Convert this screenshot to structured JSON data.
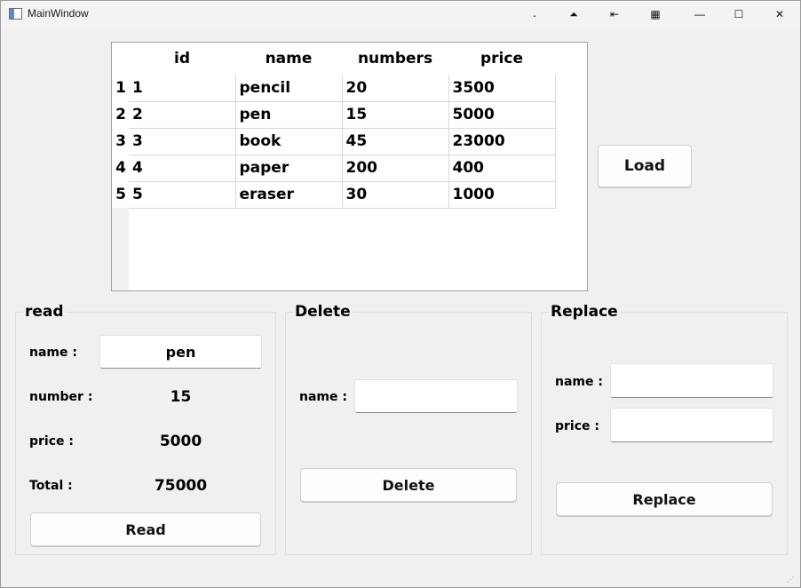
{
  "window": {
    "title": "MainWindow",
    "controls": {
      "dot": ".",
      "top": "⏶",
      "pin": "⇤",
      "grid": "▦",
      "minimize": "—",
      "maximize": "☐",
      "close": "✕"
    }
  },
  "table": {
    "columns": [
      "id",
      "name",
      "numbers",
      "price"
    ],
    "row_headers": [
      "1",
      "2",
      "3",
      "4",
      "5"
    ],
    "rows": [
      [
        "1",
        "pencil",
        "20",
        "3500"
      ],
      [
        "2",
        "pen",
        "15",
        "5000"
      ],
      [
        "3",
        "book",
        "45",
        "23000"
      ],
      [
        "4",
        "paper",
        "200",
        "400"
      ],
      [
        "5",
        "eraser",
        "30",
        "1000"
      ]
    ]
  },
  "load_button": "Load",
  "read": {
    "title": "read",
    "name_label": "name :",
    "name_value": "pen",
    "number_label": "number :",
    "number_value": "15",
    "price_label": "price :",
    "price_value": "5000",
    "total_label": "Total :",
    "total_value": "75000",
    "button": "Read"
  },
  "delete": {
    "title": "Delete",
    "name_label": "name :",
    "name_value": "",
    "button": "Delete"
  },
  "replace": {
    "title": "Replace",
    "name_label": "name :",
    "name_value": "",
    "price_label": "price :",
    "price_value": "",
    "button": "Replace"
  }
}
